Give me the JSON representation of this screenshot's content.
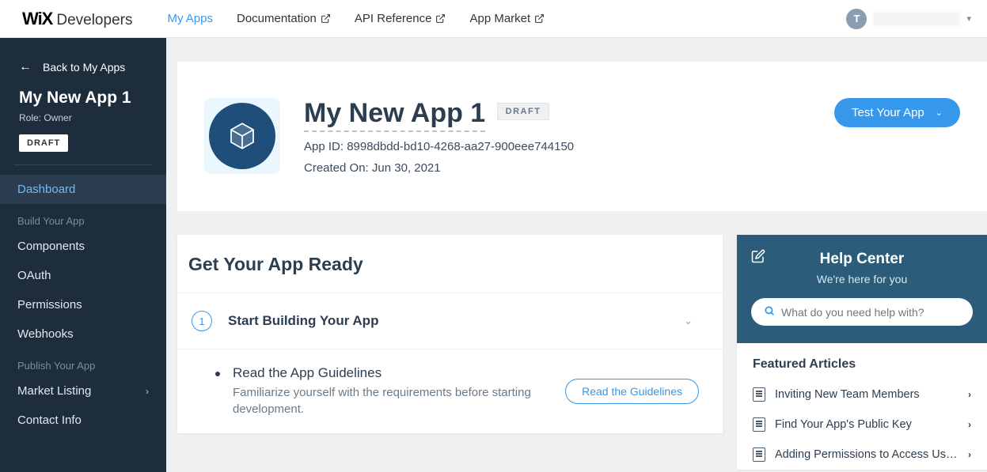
{
  "brand": {
    "wix": "WiX",
    "dev": "Developers"
  },
  "nav": {
    "my_apps": "My Apps",
    "documentation": "Documentation",
    "api_reference": "API Reference",
    "app_market": "App Market"
  },
  "user": {
    "initial": "T"
  },
  "sidebar": {
    "back": "Back to My Apps",
    "app_name": "My New App 1",
    "role": "Role: Owner",
    "draft": "DRAFT",
    "items": {
      "dashboard": "Dashboard",
      "build_section": "Build Your App",
      "components": "Components",
      "oauth": "OAuth",
      "permissions": "Permissions",
      "webhooks": "Webhooks",
      "publish_section": "Publish Your App",
      "market_listing": "Market Listing",
      "contact_info": "Contact Info"
    }
  },
  "hero": {
    "title": "My New App 1",
    "draft": "DRAFT",
    "app_id": "App ID: 8998dbdd-bd10-4268-aa27-900eee744150",
    "created": "Created On: Jun 30, 2021",
    "test_btn": "Test Your App"
  },
  "ready": {
    "heading": "Get Your App Ready",
    "step1_num": "1",
    "step1_title": "Start Building Your App",
    "sub1_title": "Read the App Guidelines",
    "sub1_desc": "Familiarize yourself with the requirements before starting development.",
    "sub1_btn": "Read the Guidelines"
  },
  "help": {
    "title": "Help Center",
    "sub": "We're here for you",
    "search_placeholder": "What do you need help with?",
    "featured": "Featured Articles",
    "articles": [
      "Inviting New Team Members",
      "Find Your App's Public Key",
      "Adding Permissions to Access User ..."
    ]
  }
}
